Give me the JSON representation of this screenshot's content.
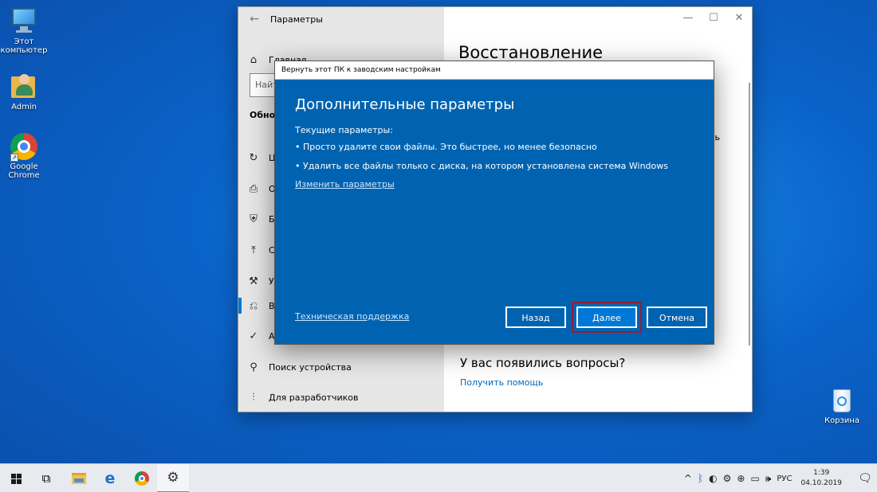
{
  "desktop": {
    "icons": [
      {
        "label": "Этот компьютер",
        "icon": "computer-icon"
      },
      {
        "label": "Admin",
        "icon": "user-folder-icon"
      },
      {
        "label": "Google Chrome",
        "icon": "chrome-icon"
      },
      {
        "label": "Корзина",
        "icon": "recycle-bin-icon"
      }
    ]
  },
  "settings": {
    "title": "Параметры",
    "back_glyph": "←",
    "controls": {
      "minimize": "—",
      "maximize": "☐",
      "close": "✕"
    },
    "home": "Главная",
    "search_placeholder": "Найт",
    "section": "Обнов",
    "nav": [
      {
        "icon": "sync-icon",
        "glyph": "↻",
        "label": "Це"
      },
      {
        "icon": "delivery-icon",
        "glyph": "⎙",
        "label": "Оп"
      },
      {
        "icon": "shield-icon",
        "glyph": "⛨",
        "label": "Бе"
      },
      {
        "icon": "backup-icon",
        "glyph": "⤒",
        "label": "Сл"
      },
      {
        "icon": "wrench-icon",
        "glyph": "⚒",
        "label": "Ус"
      },
      {
        "icon": "recovery-icon",
        "glyph": "⎌",
        "label": "Во"
      },
      {
        "icon": "activation-icon",
        "glyph": "✓",
        "label": "Ак"
      },
      {
        "icon": "find-device-icon",
        "glyph": "⚲",
        "label": "Поиск устройства"
      },
      {
        "icon": "developer-icon",
        "glyph": "⫶",
        "label": "Для разработчиков"
      }
    ],
    "page_heading": "Восстановление",
    "cut_text": "ть",
    "questions": "У вас появились вопросы?",
    "get_help": "Получить помощь"
  },
  "dialog": {
    "title": "Вернуть этот ПК к заводским настройкам",
    "heading": "Дополнительные параметры",
    "current_label": "Текущие параметры:",
    "bullets": [
      "• Просто удалите свои файлы. Это быстрее, но менее безопасно",
      "• Удалить все файлы только с диска, на котором установлена система Windows"
    ],
    "change_link": "Изменить параметры",
    "support_link": "Техническая поддержка",
    "btn_back": "Назад",
    "btn_next": "Далее",
    "btn_cancel": "Отмена"
  },
  "taskbar": {
    "tray_language": "РУС",
    "time": "1:39",
    "date": "04.10.2019"
  },
  "colors": {
    "dialog_bg": "#0063b1",
    "accent": "#0078d7",
    "highlight_border": "#8e1f3a"
  }
}
